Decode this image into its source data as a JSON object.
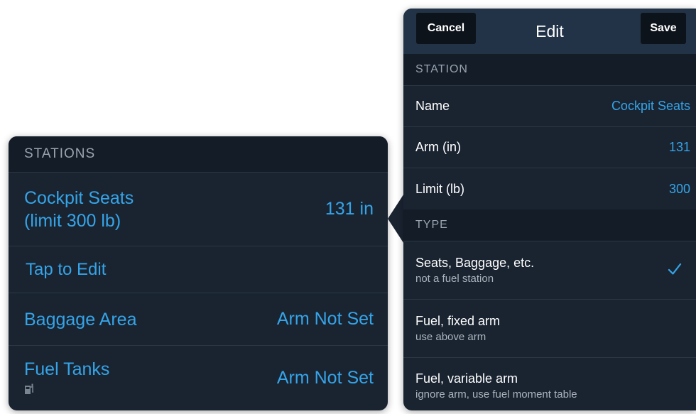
{
  "stations": {
    "header": "STATIONS",
    "rows": [
      {
        "name_line1": "Cockpit Seats",
        "name_line2": "(limit 300 lb)",
        "value": "131 in"
      },
      {
        "name": "Baggage Area",
        "value": "Arm Not Set"
      },
      {
        "name": "Fuel Tanks",
        "value": "Arm Not Set",
        "icon": "fuel-pump-icon"
      }
    ],
    "tap_to_edit": "Tap to Edit"
  },
  "edit": {
    "title": "Edit",
    "cancel_label": "Cancel",
    "save_label": "Save",
    "station_header": "STATION",
    "fields": [
      {
        "label": "Name",
        "value": "Cockpit Seats"
      },
      {
        "label": "Arm (in)",
        "value": "131"
      },
      {
        "label": "Limit (lb)",
        "value": "300"
      }
    ],
    "type_header": "TYPE",
    "types": [
      {
        "title": "Seats, Baggage, etc.",
        "subtitle": "not a fuel station",
        "selected": true
      },
      {
        "title": "Fuel, fixed arm",
        "subtitle": "use above arm",
        "selected": false
      },
      {
        "title": "Fuel, variable arm",
        "subtitle": "ignore arm, use fuel moment table",
        "selected": false
      }
    ],
    "check_icon": "checkmark-icon"
  },
  "colors": {
    "accent": "#35a4e8",
    "panel_bg": "#1a2431",
    "header_bg": "#131c27",
    "topbar_bg": "#223347"
  }
}
